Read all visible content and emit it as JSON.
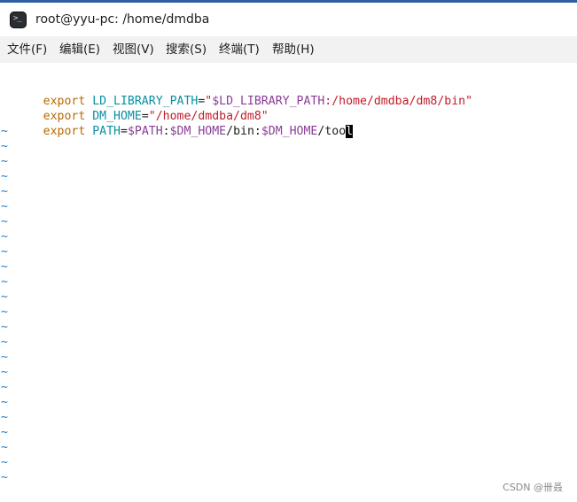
{
  "window": {
    "title": "root@yyu-pc: /home/dmdba",
    "app_icon": "terminal-icon",
    "accent_color": "#2f5fa0"
  },
  "menubar": {
    "items": [
      {
        "label": "文件(F)"
      },
      {
        "label": "编辑(E)"
      },
      {
        "label": "视图(V)"
      },
      {
        "label": "搜索(S)"
      },
      {
        "label": "终端(T)"
      },
      {
        "label": "帮助(H)"
      }
    ]
  },
  "editor": {
    "lines": [
      {
        "tokens": [
          {
            "text": "export",
            "kind": "kw"
          },
          {
            "text": " ",
            "kind": "plain"
          },
          {
            "text": "LD_LIBRARY_PATH",
            "kind": "var"
          },
          {
            "text": "=",
            "kind": "op"
          },
          {
            "text": "\"",
            "kind": "str"
          },
          {
            "text": "$LD_LIBRARY_PATH",
            "kind": "ref"
          },
          {
            "text": ":/home/dmdba/dm8/bin\"",
            "kind": "str"
          }
        ]
      },
      {
        "tokens": [
          {
            "text": "export",
            "kind": "kw"
          },
          {
            "text": " ",
            "kind": "plain"
          },
          {
            "text": "DM_HOME",
            "kind": "var"
          },
          {
            "text": "=",
            "kind": "op"
          },
          {
            "text": "\"/home/dmdba/dm8\"",
            "kind": "str"
          }
        ]
      },
      {
        "tokens": [
          {
            "text": "export",
            "kind": "kw"
          },
          {
            "text": " ",
            "kind": "plain"
          },
          {
            "text": "PATH",
            "kind": "var"
          },
          {
            "text": "=",
            "kind": "op"
          },
          {
            "text": "$PATH",
            "kind": "ref"
          },
          {
            "text": ":",
            "kind": "plain"
          },
          {
            "text": "$DM_HOME",
            "kind": "ref"
          },
          {
            "text": "/bin:",
            "kind": "plain"
          },
          {
            "text": "$DM_HOME",
            "kind": "ref"
          },
          {
            "text": "/too",
            "kind": "plain"
          },
          {
            "text": "l",
            "kind": "cursor"
          }
        ]
      }
    ],
    "empty_marker": "~",
    "empty_line_count": 24,
    "colors": {
      "keyword": "#b86a00",
      "variable": "#0b8fa3",
      "string": "#c01c28",
      "reference": "#8a3e98",
      "tilde": "#1b7fd1"
    }
  },
  "watermark": "CSDN @卌叒"
}
